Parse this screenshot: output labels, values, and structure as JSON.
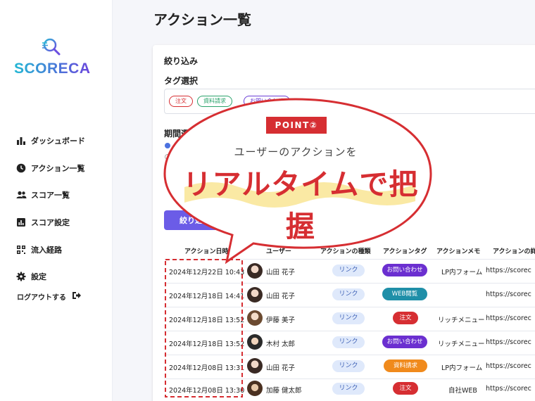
{
  "app": {
    "logo_text": "SCORECA"
  },
  "sidebar": {
    "items": [
      {
        "label": "ダッシュボード",
        "icon": "bar-chart-icon"
      },
      {
        "label": "アクション一覧",
        "icon": "clock-icon"
      },
      {
        "label": "スコア一覧",
        "icon": "users-icon"
      },
      {
        "label": "スコア設定",
        "icon": "chart-square-icon"
      },
      {
        "label": "流入経路",
        "icon": "qr-grid-icon"
      },
      {
        "label": "設定",
        "icon": "gear-icon"
      }
    ],
    "logout_label": "ログアウトする"
  },
  "page": {
    "title": "アクション一覧"
  },
  "filter": {
    "title": "絞り込み",
    "tag_section_title": "タグ選択",
    "tags": [
      {
        "label": "注文",
        "color": "#d62e32"
      },
      {
        "label": "資料請求",
        "color": "#2aa36b"
      },
      {
        "label": "お問い合わせ",
        "color": "#6b3fd6"
      }
    ],
    "period_title": "期間選択",
    "button_label": "絞り込み"
  },
  "table": {
    "headers": [
      "アクション日時",
      "ユーザー",
      "アクションの種類",
      "アクションタグ",
      "アクションメモ",
      "アクションの詳細"
    ],
    "rows": [
      {
        "datetime": "2024年12月22日 10:43",
        "user": "山田 花子",
        "type": "リンク",
        "tag": "お問い合わせ",
        "tag_color": "#6b2fd0",
        "memo": "LP内フォーム",
        "detail": "https://scorec"
      },
      {
        "datetime": "2024年12月18日 14:41",
        "user": "山田 花子",
        "type": "リンク",
        "tag": "WEB閲覧",
        "tag_color": "#1f8fa8",
        "memo": "",
        "detail": "https://scorec"
      },
      {
        "datetime": "2024年12月18日 13:52",
        "user": "伊藤 美子",
        "type": "リンク",
        "tag": "注文",
        "tag_color": "#d62e32",
        "memo": "リッチメニュー",
        "detail": "https://scorec"
      },
      {
        "datetime": "2024年12月18日 13:52",
        "user": "木村 太郎",
        "type": "リンク",
        "tag": "お問い合わせ",
        "tag_color": "#6b2fd0",
        "memo": "リッチメニュー",
        "detail": "https://scorec"
      },
      {
        "datetime": "2024年12月08日 13:31",
        "user": "山田 花子",
        "type": "リンク",
        "tag": "資料請求",
        "tag_color": "#f08a1c",
        "memo": "LP内フォーム",
        "detail": "https://scorec"
      },
      {
        "datetime": "2024年12月08日 13:30",
        "user": "加藤 健太郎",
        "type": "リンク",
        "tag": "注文",
        "tag_color": "#d62e32",
        "memo": "自社WEB",
        "detail": "https://scorec"
      }
    ]
  },
  "callout": {
    "label": "POINT②",
    "subtitle": "ユーザーのアクションを",
    "headline": "リアルタイムで把握",
    "accent_color": "#d62e32"
  }
}
